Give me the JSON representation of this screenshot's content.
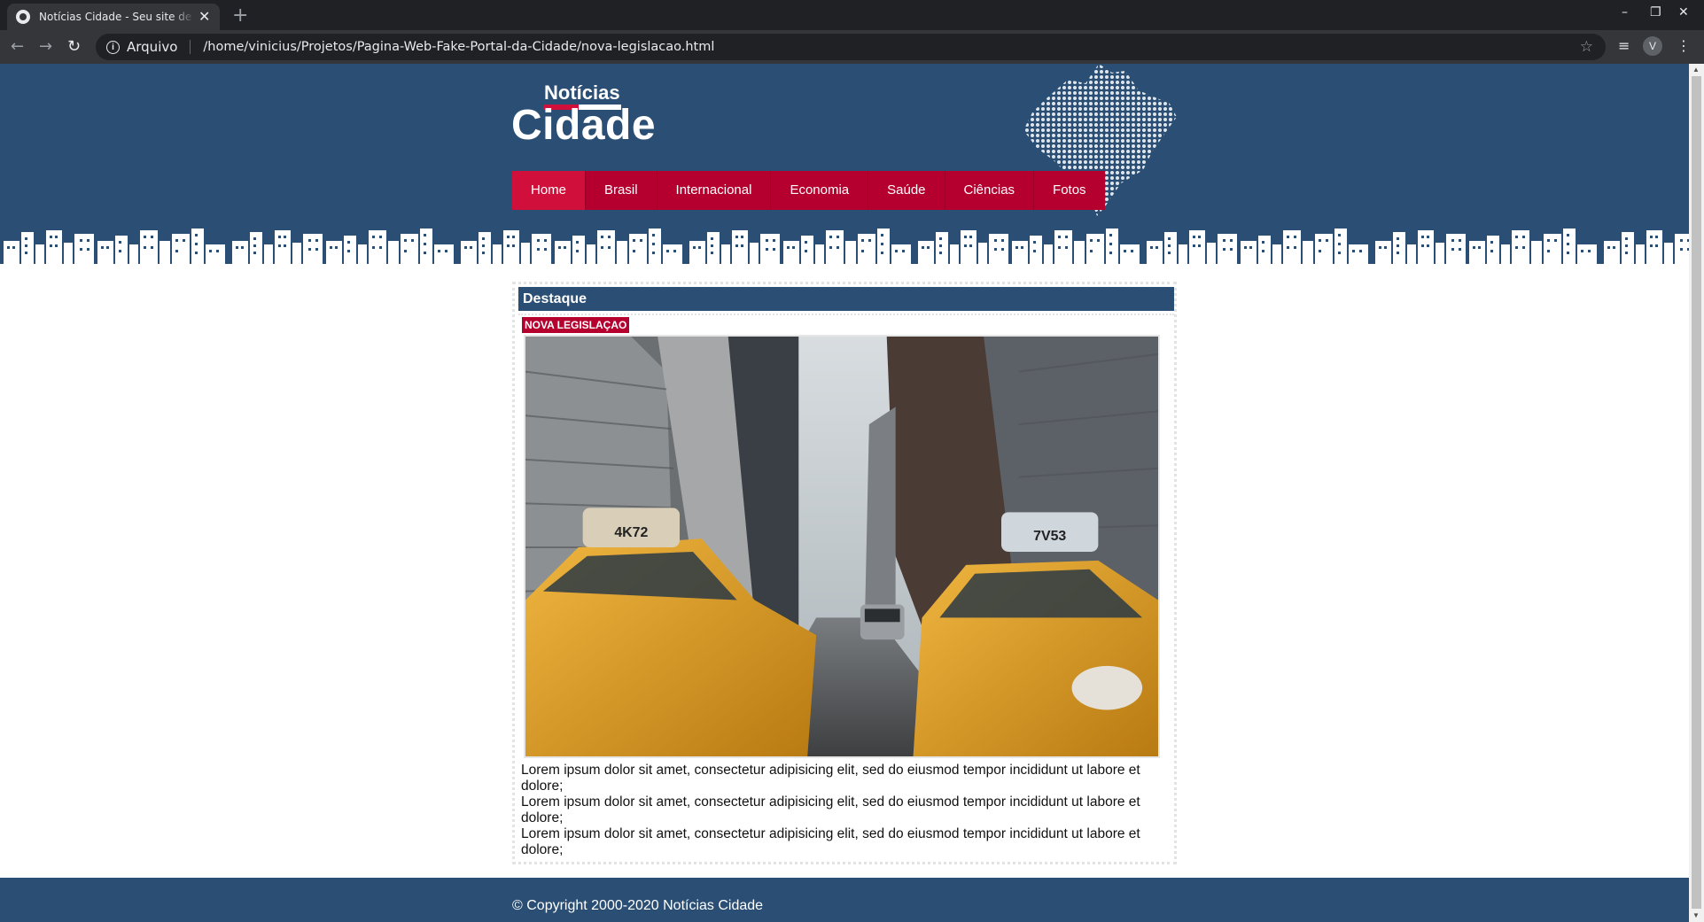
{
  "browser": {
    "tab_title": "Notícias Cidade - Seu site de notícias",
    "tab_close": "✕",
    "new_tab": "+",
    "minimize": "–",
    "restore": "❐",
    "close_window": "✕",
    "back": "←",
    "forward": "→",
    "reload": "↻",
    "address_label": "Arquivo",
    "address_url": "/home/vinicius/Projetos/Pagina-Web-Fake-Portal-da-Cidade/nova-legislacao.html",
    "star": "☆",
    "queue_icon": "≡",
    "avatar_letter": "V",
    "menu": "⋮"
  },
  "site": {
    "logo_top": "Notícias",
    "logo_main": "Cidade",
    "nav": [
      {
        "label": "Home",
        "active": true
      },
      {
        "label": "Brasil"
      },
      {
        "label": "Internacional"
      },
      {
        "label": "Economia"
      },
      {
        "label": "Saúde"
      },
      {
        "label": "Ciências"
      },
      {
        "label": "Fotos"
      }
    ]
  },
  "main": {
    "section_title": "Destaque",
    "tag": "NOVA LEGISLAÇAO",
    "paragraphs": [
      "Lorem ipsum dolor sit amet, consectetur adipisicing elit, sed do eiusmod tempor incididunt ut labore et dolore;",
      "Lorem ipsum dolor sit amet, consectetur adipisicing elit, sed do eiusmod tempor incididunt ut labore et dolore;",
      "Lorem ipsum dolor sit amet, consectetur adipisicing elit, sed do eiusmod tempor incididunt ut labore et dolore;"
    ],
    "photo_taxi_left": "4K72",
    "photo_taxi_right": "7V53"
  },
  "footer": {
    "copyright": "© Copyright 2000-2020 Notícias Cidade"
  },
  "colors": {
    "header_blue": "#2a4e74",
    "nav_red": "#b5002f",
    "nav_active": "#d0103a",
    "taxi_yellow": "#e8a62b"
  }
}
